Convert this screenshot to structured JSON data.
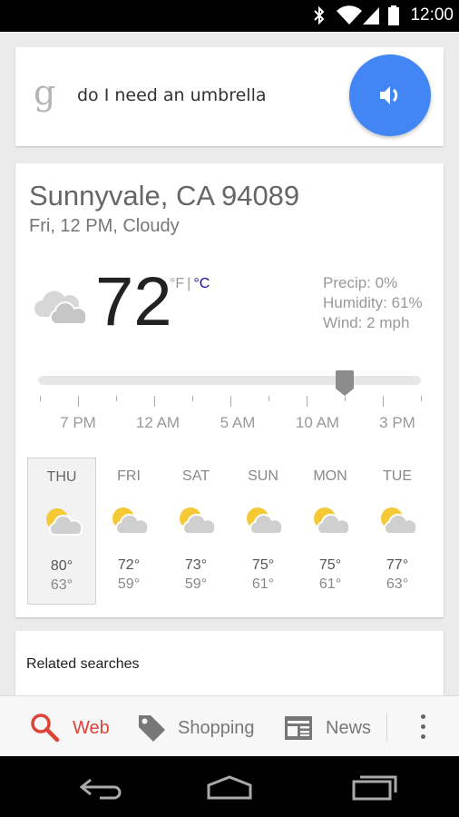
{
  "status_bar": {
    "time": "12:00"
  },
  "search": {
    "logo": "g",
    "query": "do I need an umbrella",
    "speaker_icon": "speaker-icon",
    "accent_color": "#4285f4"
  },
  "weather": {
    "location": "Sunnyvale, CA 94089",
    "condition_line": "Fri, 12 PM, Cloudy",
    "temperature": "72",
    "unit_f": "°F",
    "unit_sep": "|",
    "unit_c": "°C",
    "precip": "Precip: 0%",
    "humidity": "Humidity: 61%",
    "wind": "Wind: 2 mph",
    "current_icon": "cloudy-icon",
    "timeline_labels": [
      "7 PM",
      "12 AM",
      "5 AM",
      "10 AM",
      "3 PM"
    ],
    "timeline_position": 0.8,
    "forecast": [
      {
        "day": "THU",
        "high": "80°",
        "low": "63°",
        "icon": "partly-cloudy-icon",
        "selected": true
      },
      {
        "day": "FRI",
        "high": "72°",
        "low": "59°",
        "icon": "partly-cloudy-icon",
        "selected": false
      },
      {
        "day": "SAT",
        "high": "73°",
        "low": "59°",
        "icon": "partly-cloudy-icon",
        "selected": false
      },
      {
        "day": "SUN",
        "high": "75°",
        "low": "61°",
        "icon": "partly-cloudy-icon",
        "selected": false
      },
      {
        "day": "MON",
        "high": "75°",
        "low": "61°",
        "icon": "partly-cloudy-icon",
        "selected": false
      },
      {
        "day": "TUE",
        "high": "77°",
        "low": "63°",
        "icon": "partly-cloudy-icon",
        "selected": false
      }
    ]
  },
  "related": {
    "title": "Related searches"
  },
  "tabs": {
    "web": "Web",
    "shopping": "Shopping",
    "news": "News",
    "active_color": "#db4437"
  }
}
